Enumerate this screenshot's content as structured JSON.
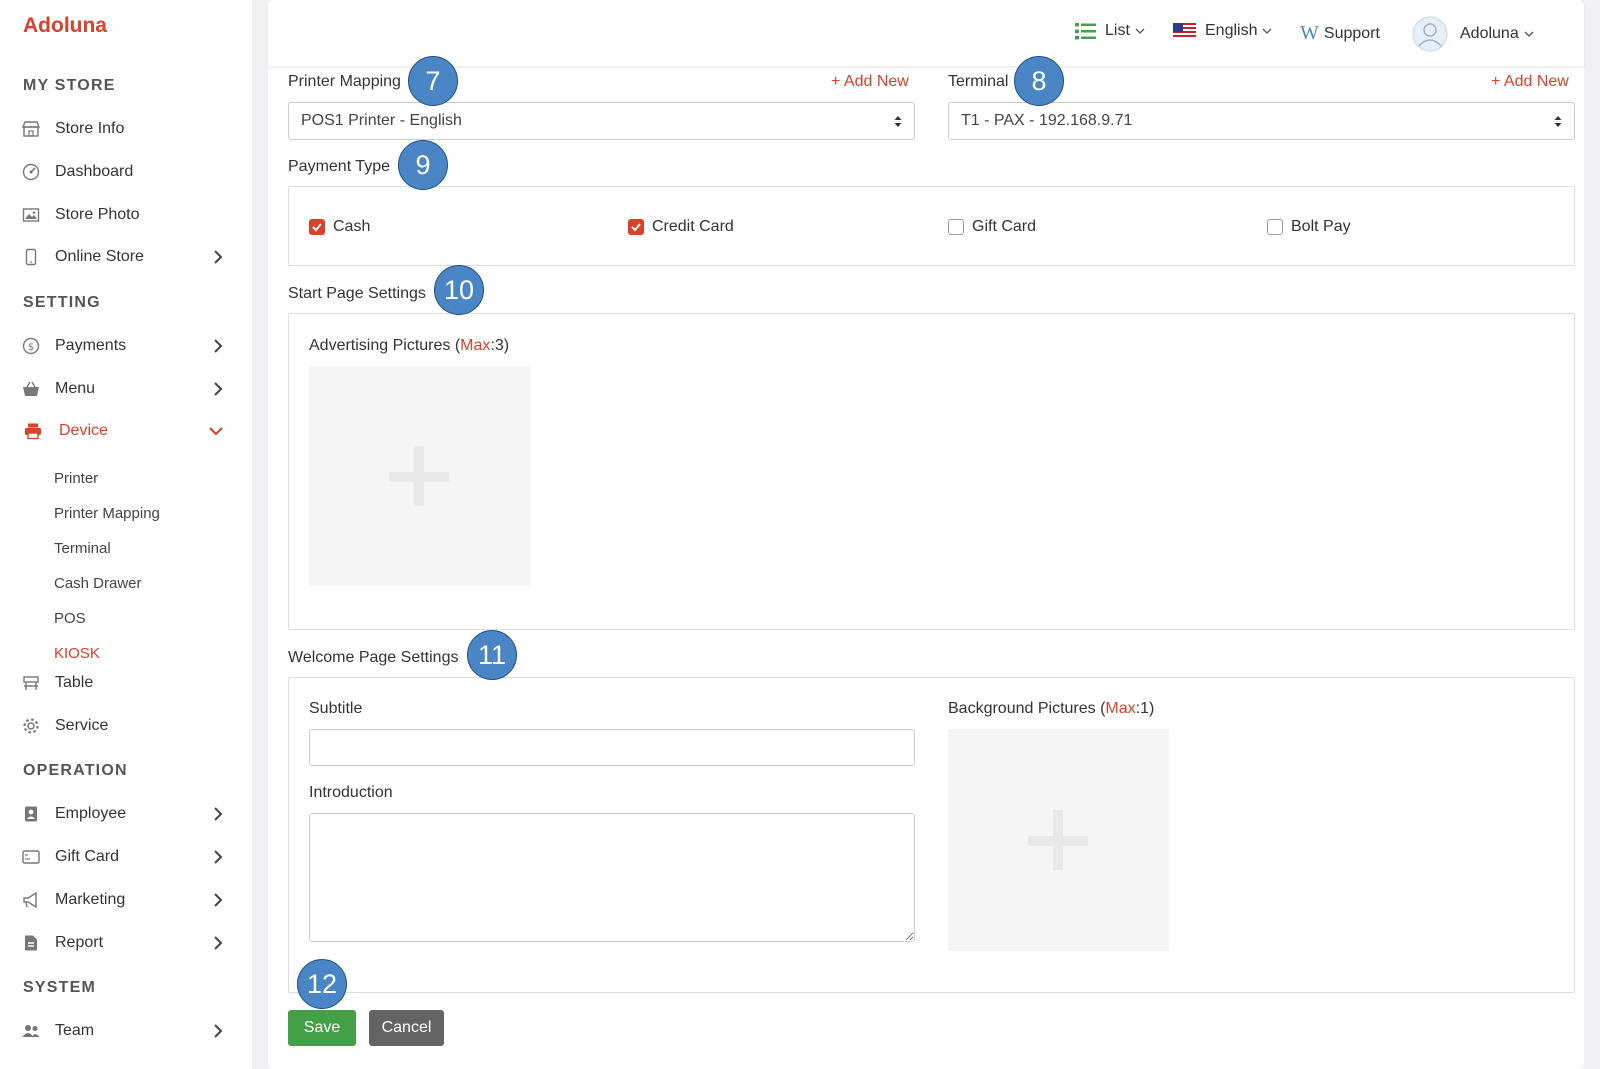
{
  "brand": "Adoluna",
  "topbar": {
    "view_label": "List",
    "language_label": "English",
    "support_label": "Support",
    "user_label": "Adoluna"
  },
  "sidebar": {
    "sections": {
      "my_store": "MY STORE",
      "setting": "SETTING",
      "operation": "OPERATION",
      "system": "SYSTEM"
    },
    "items": {
      "store_info": "Store Info",
      "dashboard": "Dashboard",
      "store_photo": "Store Photo",
      "online_store": "Online Store",
      "payments": "Payments",
      "menu": "Menu",
      "device": "Device",
      "table": "Table",
      "service": "Service",
      "employee": "Employee",
      "gift_card": "Gift Card",
      "marketing": "Marketing",
      "report": "Report",
      "team": "Team"
    },
    "device_sub": {
      "printer": "Printer",
      "printer_mapping": "Printer Mapping",
      "terminal": "Terminal",
      "cash_drawer": "Cash Drawer",
      "pos": "POS",
      "kiosk": "KIOSK"
    }
  },
  "form": {
    "printer_mapping": {
      "label": "Printer Mapping",
      "add_new": "+ Add New",
      "value": "POS1 Printer - English"
    },
    "terminal": {
      "label": "Terminal",
      "add_new": "+ Add New",
      "value": "T1 - PAX - 192.168.9.71"
    },
    "payment_type": {
      "label": "Payment Type",
      "options": [
        {
          "label": "Cash",
          "checked": true
        },
        {
          "label": "Credit Card",
          "checked": true
        },
        {
          "label": "Gift Card",
          "checked": false
        },
        {
          "label": "Bolt Pay",
          "checked": false
        }
      ]
    },
    "start_page": {
      "label": "Start Page Settings",
      "adv_label": "Advertising Pictures (",
      "adv_max": "Max",
      "adv_count": ":3)"
    },
    "welcome_page": {
      "label": "Welcome Page Settings",
      "subtitle_label": "Subtitle",
      "subtitle_value": "",
      "intro_label": "Introduction",
      "intro_value": "",
      "bg_label": "Background Pictures (",
      "bg_max": "Max",
      "bg_count": ":1)"
    },
    "save_label": "Save",
    "cancel_label": "Cancel"
  },
  "annotations": {
    "b7": "7",
    "b8": "8",
    "b9": "9",
    "b10": "10",
    "b11": "11",
    "b12": "12"
  },
  "colors": {
    "accent": "#d9412b",
    "save": "#43a047",
    "cancel": "#646464",
    "badge": "#4a86c5"
  }
}
